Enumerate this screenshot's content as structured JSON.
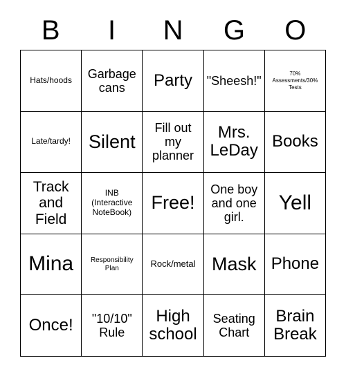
{
  "card": {
    "header_letters": [
      "B",
      "I",
      "N",
      "G",
      "O"
    ],
    "colors": {
      "background": "#ffffff",
      "text": "#000000",
      "grid_line": "#000000"
    },
    "rows": [
      [
        {
          "text": "Hats/hoods",
          "size": "fs-md"
        },
        {
          "text": "Garbage cans",
          "size": "fs-xl"
        },
        {
          "text": "Party",
          "size": "fs-3xl"
        },
        {
          "text": "\"Sheesh!\"",
          "size": "fs-xl"
        },
        {
          "text": "70% Assessments/30% Tests",
          "size": "fs-xs"
        }
      ],
      [
        {
          "text": "Late/tardy!",
          "size": "fs-md"
        },
        {
          "text": "Silent",
          "size": "fs-4xl"
        },
        {
          "text": "Fill out my planner",
          "size": "fs-xl"
        },
        {
          "text": "Mrs. LeDay",
          "size": "fs-3xl"
        },
        {
          "text": "Books",
          "size": "fs-3xl"
        }
      ],
      [
        {
          "text": "Track and Field",
          "size": "fs-2xl"
        },
        {
          "text": "INB (Interactive NoteBook)",
          "size": "fs-md"
        },
        {
          "text": "Free!",
          "size": "fs-4xl"
        },
        {
          "text": "One boy and one girl.",
          "size": "fs-xl"
        },
        {
          "text": "Yell",
          "size": "fs-5xl"
        }
      ],
      [
        {
          "text": "Mina",
          "size": "fs-5xl"
        },
        {
          "text": "Responsibility Plan",
          "size": "fs-sm"
        },
        {
          "text": "Rock/metal",
          "size": "fs-lg"
        },
        {
          "text": "Mask",
          "size": "fs-4xl"
        },
        {
          "text": "Phone",
          "size": "fs-3xl"
        }
      ],
      [
        {
          "text": "Once!",
          "size": "fs-3xl"
        },
        {
          "text": "\"10/10\" Rule",
          "size": "fs-xl"
        },
        {
          "text": "High school",
          "size": "fs-3xl"
        },
        {
          "text": "Seating Chart",
          "size": "fs-xl"
        },
        {
          "text": "Brain Break",
          "size": "fs-3xl"
        }
      ]
    ]
  }
}
